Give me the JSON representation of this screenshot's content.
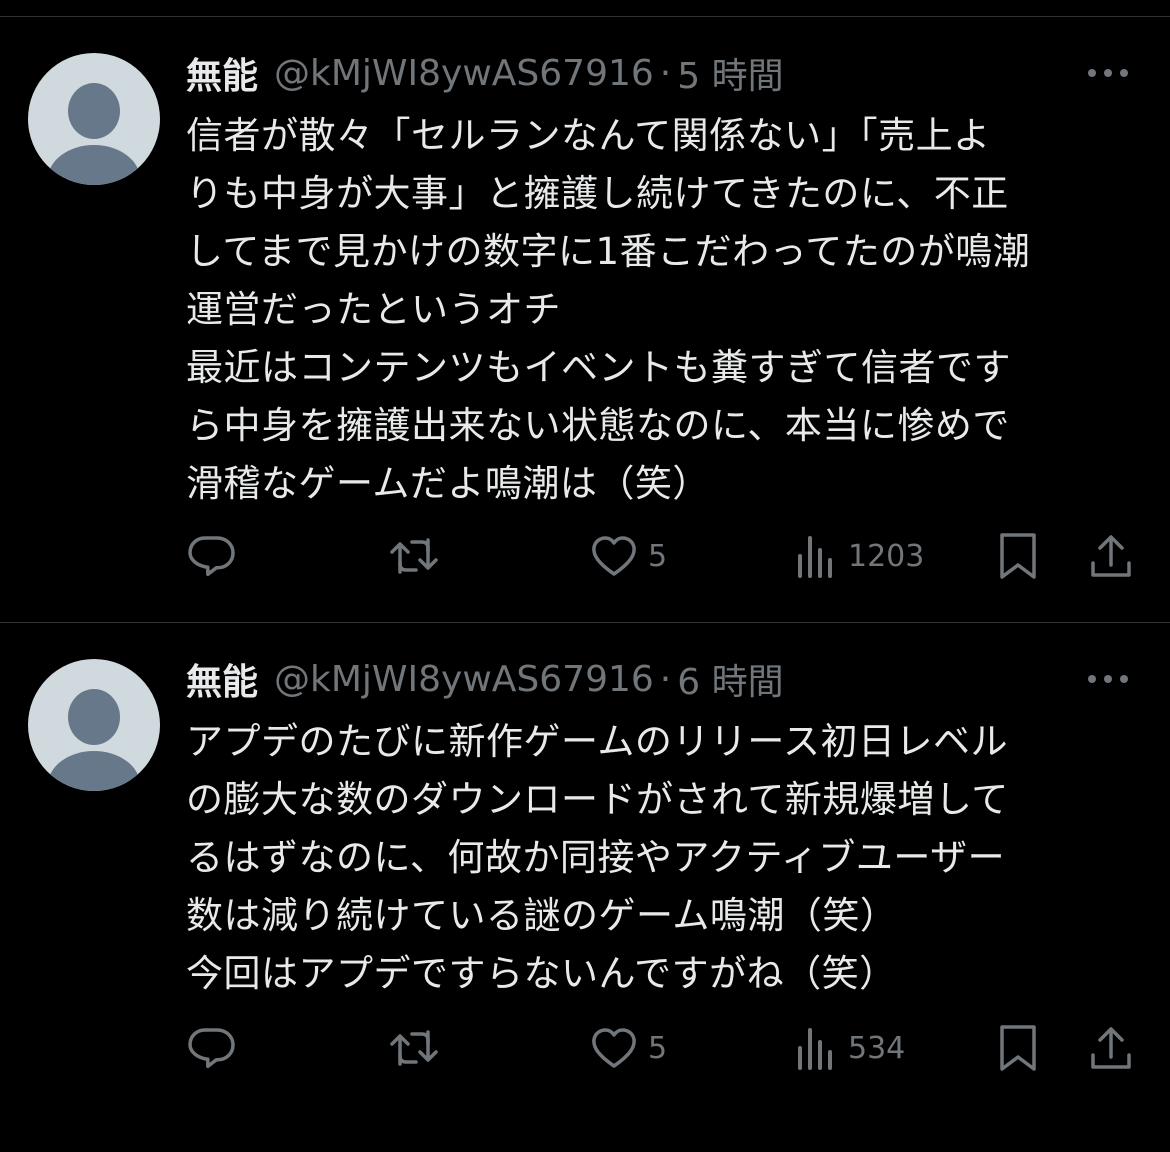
{
  "tweets": [
    {
      "display_name": "無能",
      "handle": "@kMjWI8ywAS67916",
      "separator": "·",
      "time": "5 時間",
      "body_lines": [
        "信者が散々「セルランなんて関係ない」「売上よ",
        "りも中身が大事」と擁護し続けてきたのに、不正",
        "してまで見かけの数字に1番こだわってたのが鳴潮",
        "運営だったというオチ",
        "最近はコンテンツもイベントも糞すぎて信者です",
        "ら中身を擁護出来ない状態なのに、本当に惨めで",
        "滑稽なゲームだよ鳴潮は（笑）"
      ],
      "likes": "5",
      "views": "1203"
    },
    {
      "display_name": "無能",
      "handle": "@kMjWI8ywAS67916",
      "separator": "·",
      "time": "6 時間",
      "body_lines": [
        "アプデのたびに新作ゲームのリリース初日レベル",
        "の膨大な数のダウンロードがされて新規爆増して",
        "るはずなのに、何故か同接やアクティブユーザー",
        "数は減り続けている謎のゲーム鳴潮（笑）",
        "今回はアプデですらないんですがね（笑）"
      ],
      "likes": "5",
      "views": "534"
    }
  ],
  "icons": {
    "avatar": "default-avatar-icon",
    "more": "more-horizontal-icon",
    "reply": "reply-icon",
    "retweet": "retweet-icon",
    "like": "heart-icon",
    "views": "views-icon",
    "bookmark": "bookmark-icon",
    "share": "share-icon"
  },
  "colors": {
    "background": "#000000",
    "text": "#e7e9ea",
    "secondary": "#71767b",
    "divider": "#2f3336",
    "avatar_bg": "#cfd9de",
    "avatar_figure": "#66788a"
  }
}
